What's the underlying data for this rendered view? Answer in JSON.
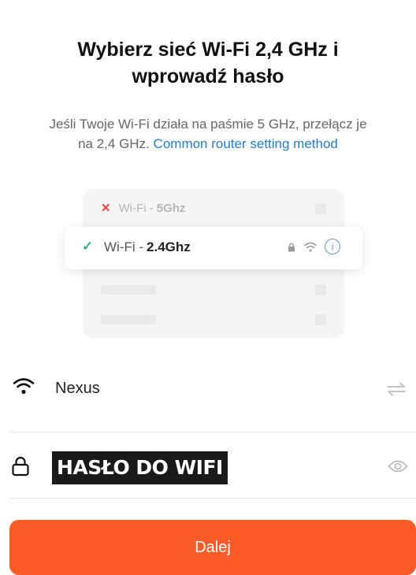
{
  "header": {
    "title_line1": "Wybierz sieć Wi-Fi 2,4 GHz i",
    "title_line2": "wprowadź hasło",
    "subtitle_line1": "Jeśli Twoje Wi-Fi działa na paśmie 5 GHz, przełącz je",
    "subtitle_line2_prefix": "na 2,4 GHz.",
    "subtitle_link": "Common router setting method"
  },
  "illustration": {
    "row_5g": {
      "prefix": "Wi-Fi -",
      "band": "5Ghz",
      "icon": "x-icon"
    },
    "row_24g": {
      "prefix": "Wi-Fi -",
      "band": "2.4Ghz",
      "icon": "check-icon"
    },
    "colors": {
      "check": "#2cb58c",
      "cross": "#f0453a",
      "info": "#5b9ad8"
    }
  },
  "form": {
    "ssid_value": "Nexus",
    "password_value": "HASŁO DO WIFI"
  },
  "actions": {
    "next_label": "Dalej",
    "next_color": "#fb5b27"
  },
  "icons": [
    "wifi-icon",
    "swap-icon",
    "lock-icon",
    "eye-icon",
    "info-icon"
  ]
}
